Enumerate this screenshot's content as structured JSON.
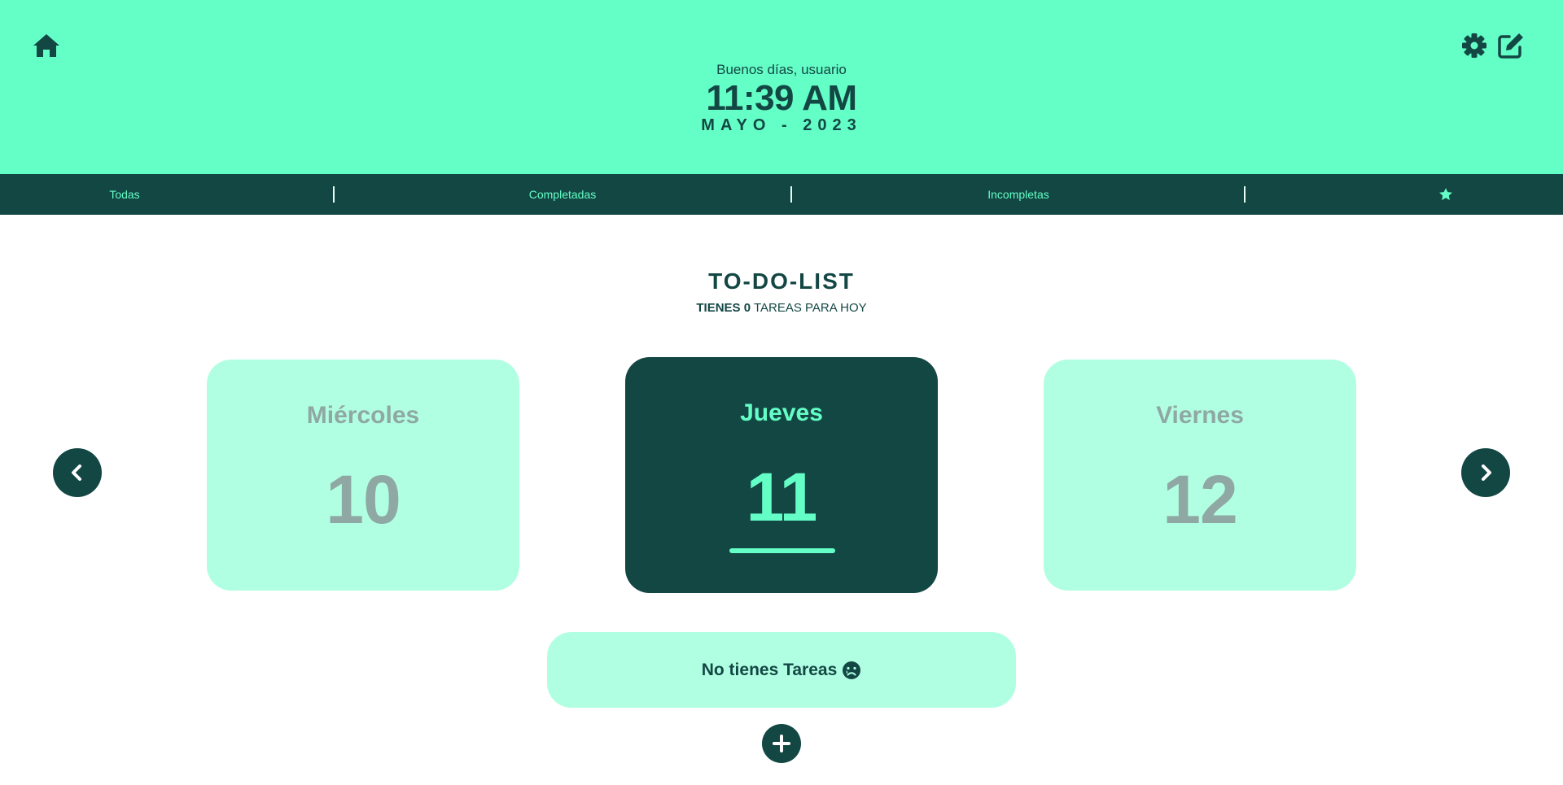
{
  "header": {
    "greeting": "Buenos días, usuario",
    "time": "11:39 AM",
    "month_year": "MAYO - 2023",
    "icons": [
      "home-icon",
      "gear-icon",
      "edit-icon"
    ]
  },
  "filters": {
    "all": "Todas",
    "completed": "Completadas",
    "incomplete": "Incompletas",
    "favorites_icon": "star-icon"
  },
  "main": {
    "title": "TO-DO-LIST",
    "subtitle_prefix": "TIENES",
    "task_count": "0",
    "subtitle_suffix": "TAREAS PARA HOY"
  },
  "days": [
    {
      "name": "Miércoles",
      "number": "10",
      "selected": false
    },
    {
      "name": "Jueves",
      "number": "11",
      "selected": true
    },
    {
      "name": "Viernes",
      "number": "12",
      "selected": false
    }
  ],
  "empty_state": {
    "message": "No tienes Tareas",
    "icon": "sad-face-icon"
  },
  "colors": {
    "accent": "#64ffc6",
    "dark": "#134744",
    "card_light": "#b1ffe2",
    "muted_text": "#8fa8a3"
  }
}
